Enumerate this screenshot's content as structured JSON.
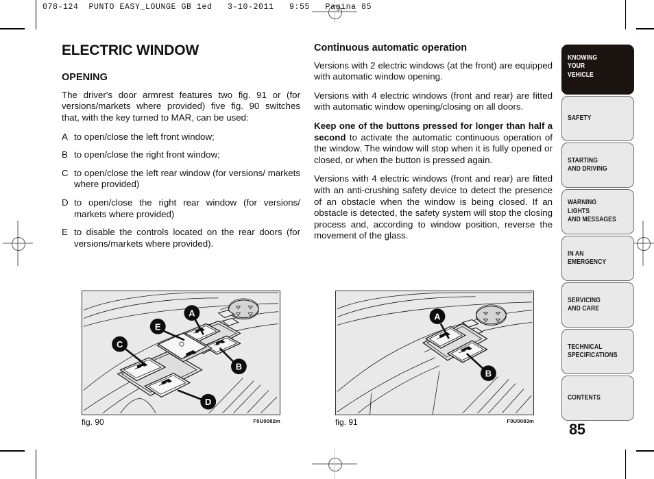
{
  "page_header": "078-124  PUNTO EASY_LOUNGE GB 1ed   3-10-2011   9:55   Pagina 85",
  "page_number": "85",
  "left_column": {
    "title": "ELECTRIC WINDOW",
    "section_heading": "OPENING",
    "intro": "The driver's door armrest features two fig. 91 or (for versions/markets where provided) five fig. 90 switches that, with the key turned to MAR, can be used:",
    "items": [
      {
        "letter": "A",
        "text": "to open/close the left front window;"
      },
      {
        "letter": "B",
        "text": "to open/close the right front window;"
      },
      {
        "letter": "C",
        "text": "to open/close the left rear window (for versions/ markets where provided)"
      },
      {
        "letter": "D",
        "text": "to open/close the right rear window (for versions/ markets where provided)"
      },
      {
        "letter": "E",
        "text": "to disable the controls located on the rear doors (for versions/markets where provided)."
      }
    ]
  },
  "right_column": {
    "heading": "Continuous automatic operation",
    "para1": "Versions with 2 electric windows (at the front) are equipped with automatic window opening.",
    "para2": "Versions with 4 electric windows (front and rear) are fitted with automatic window opening/closing on all doors.",
    "para3_bold": "Keep one of the buttons pressed for longer than half a second",
    "para3_rest": " to activate the automatic continuous operation of the window. The window will stop when it is fully opened or closed, or when the button is pressed again.",
    "para4": "Versions with 4 electric windows (front and rear) are fitted with an anti-crushing safety device to detect the presence of an obstacle when the window is being closed. If an obstacle is detected, the safety system will stop the closing process and, according to window position, reverse the movement of the glass."
  },
  "figures": [
    {
      "caption": "fig. 90",
      "code": "F0U0082m",
      "callouts": [
        "A",
        "B",
        "C",
        "D",
        "E"
      ],
      "description": "driver door armrest with five electric window switches"
    },
    {
      "caption": "fig. 91",
      "code": "F0U0083m",
      "callouts": [
        "A",
        "B"
      ],
      "description": "driver door armrest with two electric window switches"
    }
  ],
  "sidebar": {
    "items": [
      {
        "label": "KNOWING\nYOUR\nVEHICLE",
        "active": true
      },
      {
        "label": "SAFETY",
        "active": false
      },
      {
        "label": "STARTING\nAND DRIVING",
        "active": false
      },
      {
        "label": "WARNING LIGHTS\nAND MESSAGES",
        "active": false
      },
      {
        "label": "IN AN\nEMERGENCY",
        "active": false
      },
      {
        "label": "SERVICING\nAND CARE",
        "active": false
      },
      {
        "label": "TECHNICAL\nSPECIFICATIONS",
        "active": false
      },
      {
        "label": "CONTENTS",
        "active": false
      }
    ]
  },
  "colors": {
    "active_tab_bg": "#1c1411",
    "tab_bg": "#e9e9e9",
    "figure_bg": "#e9e9e9",
    "text": "#111111"
  }
}
